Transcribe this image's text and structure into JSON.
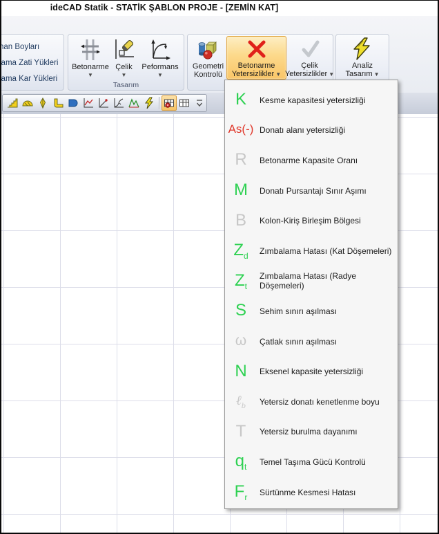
{
  "window": {
    "title": "ideCAD Statik - STATİK ŞABLON PROJE - [ZEMİN KAT]"
  },
  "left_panel": {
    "items": [
      "nan Boyları",
      "lama Zati Yükleri",
      "lama Kar Yükleri"
    ]
  },
  "ribbon": {
    "tasarim_group_label": "Tasarım",
    "buttons": {
      "betonarme": {
        "label": "Betonarme",
        "icon": "betonarme-icon",
        "arrow": true
      },
      "celik": {
        "label": "Çelik",
        "icon": "celik-icon",
        "arrow": true
      },
      "performans": {
        "label": "Peformans",
        "icon": "performans-icon",
        "arrow": true
      },
      "geometri": {
        "label": "Geometri Kontrolü",
        "icon": "geometri-kontrolu-icon",
        "arrow": false
      },
      "betonarme_yetersizlikler": {
        "label": "Betonarme Yetersizlikler",
        "icon": "red-x-icon",
        "arrow": true,
        "active": true
      },
      "celik_yetersizlikler": {
        "label": "Çelik Yetersizlikler",
        "icon": "gray-check-icon",
        "arrow": true
      },
      "analiz_tasarim": {
        "label": "Analiz Tasarım",
        "icon": "lightning-icon",
        "arrow": true
      }
    }
  },
  "toolbar": {
    "items": [
      {
        "name": "stairs-icon"
      },
      {
        "name": "dome-icon"
      },
      {
        "name": "plumb-icon"
      },
      {
        "name": "corner-icon"
      },
      {
        "name": "slab-icon"
      },
      {
        "name": "chart-line-icon"
      },
      {
        "name": "chart-point-icon"
      },
      {
        "name": "chart-curve-icon"
      },
      {
        "name": "spectrum-icon"
      },
      {
        "name": "lightning-small-icon"
      },
      {
        "name": "separator"
      },
      {
        "name": "grid-settings-icon",
        "active": true
      },
      {
        "name": "grid-icon"
      },
      {
        "name": "toolbar-overflow-icon"
      }
    ]
  },
  "menu": {
    "items": [
      {
        "symbol": "K",
        "sub": "",
        "style": "letter",
        "color": "green",
        "label": "Kesme kapasitesi yetersizliği"
      },
      {
        "symbol": "As(-)",
        "sub": "",
        "style": "as",
        "color": "red",
        "label": "Donatı alanı yetersizliği"
      },
      {
        "symbol": "R",
        "sub": "",
        "style": "letter",
        "color": "gray",
        "label": "Betonarme Kapasite Oranı"
      },
      {
        "symbol": "M",
        "sub": "",
        "style": "letter",
        "color": "green",
        "label": "Donatı Pursantajı Sınır Aşımı"
      },
      {
        "symbol": "B",
        "sub": "",
        "style": "letter",
        "color": "gray",
        "label": "Kolon-Kiriş Birleşim Bölgesi"
      },
      {
        "symbol": "Z",
        "sub": "d",
        "style": "letter",
        "color": "green",
        "label": "Zımbalama Hatası (Kat Döşemeleri)"
      },
      {
        "symbol": "Z",
        "sub": "t",
        "style": "letter",
        "color": "green",
        "label": "Zımbalama Hatası (Radye Döşemeleri)"
      },
      {
        "symbol": "S",
        "sub": "",
        "style": "letter",
        "color": "green",
        "label": "Sehim sınırı aşılması"
      },
      {
        "symbol": "ω",
        "sub": "",
        "style": "omega",
        "color": "gray",
        "label": "Çatlak sınırı aşılması"
      },
      {
        "symbol": "N",
        "sub": "",
        "style": "letter",
        "color": "green",
        "label": "Eksenel kapasite yetersizliği"
      },
      {
        "symbol": "ℓ",
        "sub": "b",
        "style": "ell",
        "color": "gray",
        "label": "Yetersiz donatı kenetlenme boyu"
      },
      {
        "symbol": "T",
        "sub": "",
        "style": "letter",
        "color": "gray",
        "label": "Yetersiz burulma dayanımı"
      },
      {
        "symbol": "q",
        "sub": "t",
        "style": "letter",
        "color": "green",
        "label": "Temel Taşıma Gücü Kontrolü"
      },
      {
        "symbol": "F",
        "sub": "r",
        "style": "letter",
        "color": "green",
        "label": "Sürtünme Kesmesi Hatası"
      }
    ]
  },
  "colors": {
    "green": "#2ed152",
    "red": "#e0382b",
    "gray": "#c7c7c7",
    "active_orange": "#f9c568",
    "grid_line": "#dcdde9"
  }
}
